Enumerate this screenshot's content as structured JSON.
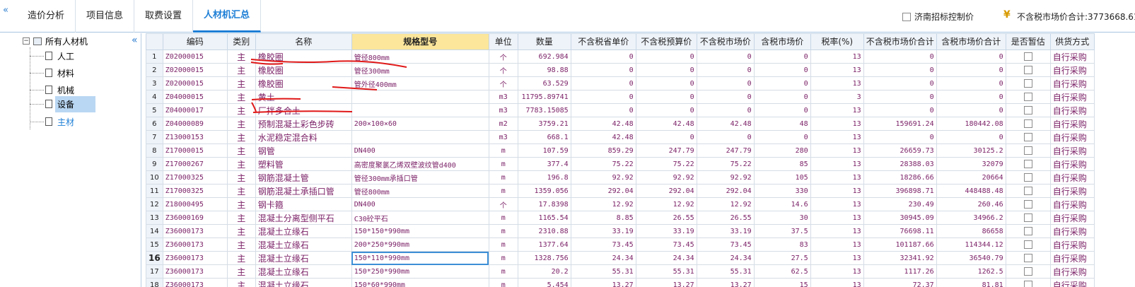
{
  "tabs": [
    {
      "label": "造价分析"
    },
    {
      "label": "项目信息"
    },
    {
      "label": "取费设置"
    },
    {
      "label": "人材机汇总"
    }
  ],
  "topbar": {
    "jinan_label": "济南招标控制价",
    "total_label": "不含税市场价合计:3773668.61"
  },
  "tree": {
    "root": "所有人材机",
    "items": [
      {
        "label": "人工"
      },
      {
        "label": "材料"
      },
      {
        "label": "机械"
      },
      {
        "label": "设备"
      },
      {
        "label": "主材"
      }
    ]
  },
  "columns": [
    "",
    "编码",
    "类别",
    "名称",
    "规格型号",
    "单位",
    "数量",
    "不含税省单价",
    "不含税预算价",
    "不含税市场价",
    "含税市场价",
    "税率(%)",
    "不含税市场价合计",
    "含税市场价合计",
    "是否暂估",
    "供货方式"
  ],
  "rows": [
    {
      "n": "1",
      "code": "Z02000015",
      "type": "主",
      "name": "橡胶圈",
      "spec": "管径800mm",
      "unit": "个",
      "qty": "692.984",
      "p1": "0",
      "p2": "0",
      "p3": "0",
      "p4": "0",
      "tax": "13",
      "t1": "0",
      "t2": "0",
      "supply": "自行采购"
    },
    {
      "n": "2",
      "code": "Z02000015",
      "type": "主",
      "name": "橡胶圈",
      "spec": "管径300mm",
      "unit": "个",
      "qty": "98.88",
      "p1": "0",
      "p2": "0",
      "p3": "0",
      "p4": "0",
      "tax": "13",
      "t1": "0",
      "t2": "0",
      "supply": "自行采购"
    },
    {
      "n": "3",
      "code": "Z02000015",
      "type": "主",
      "name": "橡胶圈",
      "spec": "管外径400mm",
      "unit": "个",
      "qty": "63.529",
      "p1": "0",
      "p2": "0",
      "p3": "0",
      "p4": "0",
      "tax": "13",
      "t1": "0",
      "t2": "0",
      "supply": "自行采购"
    },
    {
      "n": "4",
      "code": "Z04000015",
      "type": "主",
      "name": "黄土",
      "spec": "",
      "unit": "m3",
      "qty": "11795.89741",
      "p1": "0",
      "p2": "0",
      "p3": "0",
      "p4": "0",
      "tax": "3",
      "t1": "0",
      "t2": "0",
      "supply": "自行采购"
    },
    {
      "n": "5",
      "code": "Z04000017",
      "type": "主",
      "name": "厂拌多合土",
      "spec": "",
      "unit": "m3",
      "qty": "7783.15085",
      "p1": "0",
      "p2": "0",
      "p3": "0",
      "p4": "0",
      "tax": "13",
      "t1": "0",
      "t2": "0",
      "supply": "自行采购"
    },
    {
      "n": "6",
      "code": "Z04000089",
      "type": "主",
      "name": "预制混凝土彩色步砖",
      "spec": "200×100×60",
      "unit": "m2",
      "qty": "3759.21",
      "p1": "42.48",
      "p2": "42.48",
      "p3": "42.48",
      "p4": "48",
      "tax": "13",
      "t1": "159691.24",
      "t2": "180442.08",
      "supply": "自行采购"
    },
    {
      "n": "7",
      "code": "Z13000153",
      "type": "主",
      "name": "水泥稳定混合料",
      "spec": "",
      "unit": "m3",
      "qty": "668.1",
      "p1": "42.48",
      "p2": "0",
      "p3": "0",
      "p4": "0",
      "tax": "13",
      "t1": "0",
      "t2": "0",
      "supply": "自行采购"
    },
    {
      "n": "8",
      "code": "Z17000015",
      "type": "主",
      "name": "钢管",
      "spec": "DN400",
      "unit": "m",
      "qty": "107.59",
      "p1": "859.29",
      "p2": "247.79",
      "p3": "247.79",
      "p4": "280",
      "tax": "13",
      "t1": "26659.73",
      "t2": "30125.2",
      "supply": "自行采购"
    },
    {
      "n": "9",
      "code": "Z17000267",
      "type": "主",
      "name": "塑料管",
      "spec": "高密度聚氯乙烯双壁波纹管d400",
      "unit": "m",
      "qty": "377.4",
      "p1": "75.22",
      "p2": "75.22",
      "p3": "75.22",
      "p4": "85",
      "tax": "13",
      "t1": "28388.03",
      "t2": "32079",
      "supply": "自行采购"
    },
    {
      "n": "10",
      "code": "Z17000325",
      "type": "主",
      "name": "钢筋混凝土管",
      "spec": "管径300mm承插口管",
      "unit": "m",
      "qty": "196.8",
      "p1": "92.92",
      "p2": "92.92",
      "p3": "92.92",
      "p4": "105",
      "tax": "13",
      "t1": "18286.66",
      "t2": "20664",
      "supply": "自行采购"
    },
    {
      "n": "11",
      "code": "Z17000325",
      "type": "主",
      "name": "钢筋混凝土承插口管",
      "spec": "管径800mm",
      "unit": "m",
      "qty": "1359.056",
      "p1": "292.04",
      "p2": "292.04",
      "p3": "292.04",
      "p4": "330",
      "tax": "13",
      "t1": "396898.71",
      "t2": "448488.48",
      "supply": "自行采购"
    },
    {
      "n": "12",
      "code": "Z18000495",
      "type": "主",
      "name": "钢卡箍",
      "spec": "DN400",
      "unit": "个",
      "qty": "17.8398",
      "p1": "12.92",
      "p2": "12.92",
      "p3": "12.92",
      "p4": "14.6",
      "tax": "13",
      "t1": "230.49",
      "t2": "260.46",
      "supply": "自行采购"
    },
    {
      "n": "13",
      "code": "Z36000169",
      "type": "主",
      "name": "混凝土分离型侧平石",
      "spec": "C30砼平石",
      "unit": "m",
      "qty": "1165.54",
      "p1": "8.85",
      "p2": "26.55",
      "p3": "26.55",
      "p4": "30",
      "tax": "13",
      "t1": "30945.09",
      "t2": "34966.2",
      "supply": "自行采购"
    },
    {
      "n": "14",
      "code": "Z36000173",
      "type": "主",
      "name": "混凝土立缘石",
      "spec": "150*150*990mm",
      "unit": "m",
      "qty": "2310.88",
      "p1": "33.19",
      "p2": "33.19",
      "p3": "33.19",
      "p4": "37.5",
      "tax": "13",
      "t1": "76698.11",
      "t2": "86658",
      "supply": "自行采购"
    },
    {
      "n": "15",
      "code": "Z36000173",
      "type": "主",
      "name": "混凝土立缘石",
      "spec": "200*250*990mm",
      "unit": "m",
      "qty": "1377.64",
      "p1": "73.45",
      "p2": "73.45",
      "p3": "73.45",
      "p4": "83",
      "tax": "13",
      "t1": "101187.66",
      "t2": "114344.12",
      "supply": "自行采购"
    },
    {
      "n": "16",
      "code": "Z36000173",
      "type": "主",
      "name": "混凝土立缘石",
      "spec": "150*110*990mm",
      "unit": "m",
      "qty": "1328.756",
      "p1": "24.34",
      "p2": "24.34",
      "p3": "24.34",
      "p4": "27.5",
      "tax": "13",
      "t1": "32341.92",
      "t2": "36540.79",
      "supply": "自行采购"
    },
    {
      "n": "17",
      "code": "Z36000173",
      "type": "主",
      "name": "混凝土立缘石",
      "spec": "150*250*990mm",
      "unit": "m",
      "qty": "20.2",
      "p1": "55.31",
      "p2": "55.31",
      "p3": "55.31",
      "p4": "62.5",
      "tax": "13",
      "t1": "1117.26",
      "t2": "1262.5",
      "supply": "自行采购"
    },
    {
      "n": "18",
      "code": "Z36000173",
      "type": "主",
      "name": "混凝土立缘石",
      "spec": "150*60*990mm",
      "unit": "m",
      "qty": "5.454",
      "p1": "13.27",
      "p2": "13.27",
      "p3": "13.27",
      "p4": "15",
      "tax": "13",
      "t1": "72.37",
      "t2": "81.81",
      "supply": "自行采购"
    }
  ]
}
